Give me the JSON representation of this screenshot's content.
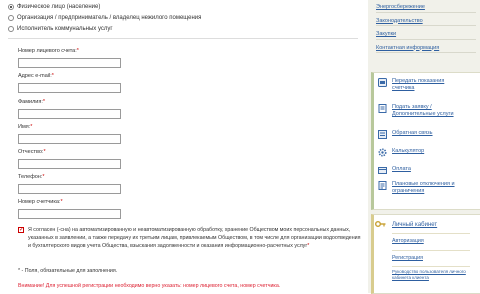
{
  "person_type": {
    "options": [
      {
        "label": "Физическое лицо (население)",
        "selected": true
      },
      {
        "label": "Организация / предприниматель / владелец нежилого помещения",
        "selected": false
      },
      {
        "label": "Исполнитель коммунальных услуг",
        "selected": false
      }
    ]
  },
  "form": {
    "fields": [
      {
        "label": "Номер лицевого счета:",
        "required_mark": "*",
        "value": ""
      },
      {
        "label": "Адрес e-mail:",
        "required_mark": "*",
        "value": ""
      },
      {
        "label": "Фамилия:",
        "required_mark": "*",
        "value": ""
      },
      {
        "label": "Имя:",
        "required_mark": "*",
        "value": ""
      },
      {
        "label": "Отчество:",
        "required_mark": "*",
        "value": ""
      },
      {
        "label": "Телефон:",
        "required_mark": "*",
        "value": ""
      },
      {
        "label": "Номер счетчика:",
        "required_mark": "*",
        "value": ""
      }
    ],
    "consent_text": "Я согласен (-сна) на автоматизированную и неавтоматизированную обработку, хранение Обществом моих персональных данных, указанных в заявлении, а также передачу их третьим лицам, привлекаемым Обществом, в том числе для организации водоотведения и бухгалтерского видов учета Общества, взыскания задолженности и оказания информационно-расчетных услуг",
    "consent_required_mark": "*",
    "consent_checked": true,
    "note": "* - Поля, обязательные для заполнения.",
    "warning": "Внимание! Для успешной регистрации необходимо верно указать: номер лицевого счета, номер счетчика."
  },
  "sidebar": {
    "top_links": [
      "Энергосбережение",
      "Законодательство",
      "Закупки",
      "Контактная информация"
    ],
    "services": [
      {
        "label": "Передать показания счетчика",
        "icon": "meter-icon"
      },
      {
        "label": "Подать заявку / Дополнительные услуги",
        "icon": "document-icon"
      },
      {
        "label": "Обратная связь",
        "icon": "feedback-icon"
      },
      {
        "label": "Калькулятор",
        "icon": "gear-icon"
      },
      {
        "label": "Оплата",
        "icon": "payment-icon"
      },
      {
        "label": "Плановые отключения и ограничения",
        "icon": "schedule-icon"
      }
    ],
    "cabinet": {
      "title": "Личный кабинет",
      "links": [
        "Авторизация",
        "Регистрация",
        "Руководство пользователя личного кабинета клиента"
      ]
    }
  },
  "colors": {
    "link": "#2e5fa0",
    "warning": "#d23",
    "sidebar_bg": "#f1f1ea"
  }
}
